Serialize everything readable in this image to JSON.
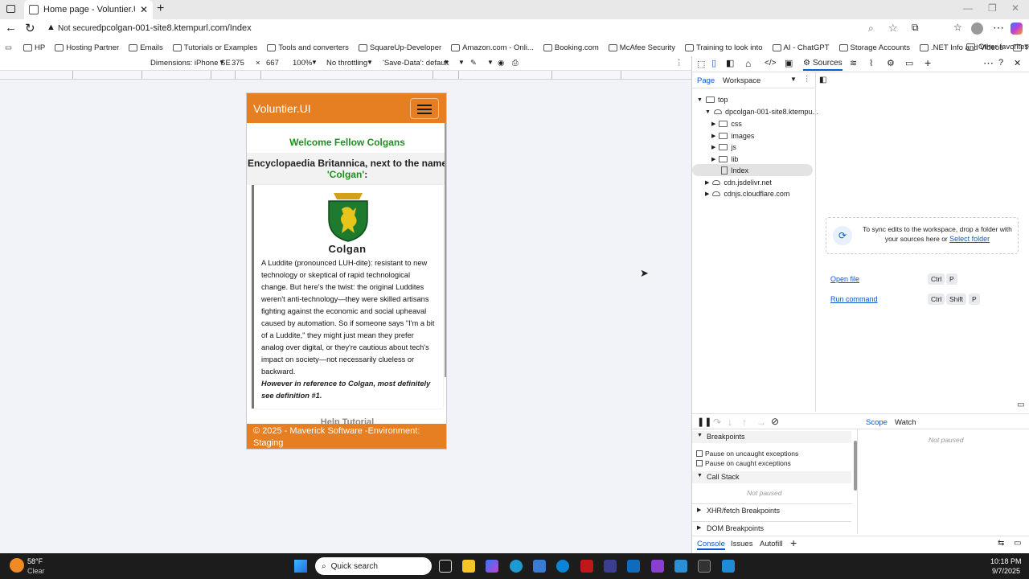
{
  "browser": {
    "tab_title": "Home page - Voluntier.UI",
    "security": "Not secure",
    "url": "dpcolgan-001-site8.ktempurl.com/Index",
    "favorites": [
      "HP",
      "Hosting Partner",
      "Emails",
      "Tutorials or Examples",
      "Tools and converters",
      "SquareUp-Developer",
      "Amazon.com - Onli...",
      "Booking.com",
      "McAfee Security",
      "Training to look into",
      "AI - ChatGPT",
      "Storage Accounts",
      ".NET Info and Videos",
      "Twilio"
    ],
    "other_favorites": "Other favorites"
  },
  "device_toolbar": {
    "dimensions": "Dimensions: iPhone SE",
    "width": "375",
    "x": "×",
    "height": "667",
    "zoom": "100%",
    "throttling": "No throttling",
    "save_data": "'Save-Data': default"
  },
  "site": {
    "brand": "Voluntier.UI",
    "welcome": "Welcome Fellow Colgans",
    "heading_pre": "Encyclopaedia Britannica, next to the name",
    "heading_name": "'Colgan'",
    "heading_post": ":",
    "crest_caption": "Colgan",
    "description": "A Luddite (pronounced LUH-dite): resistant to new technology or skeptical of rapid technological change. But here's the twist: the original Luddites weren't anti-technology—they were skilled artisans fighting against the economic and social upheaval caused by automation. So if someone says \"I'm a bit of a Luddite,\" they might just mean they prefer analog over digital, or they're cautious about tech's impact on society—not necessarily clueless or backward.",
    "emphasis": "However in reference to Colgan, most definitely see definition #1.",
    "help_tutorial": "Help Tutorial",
    "footer": "© 2025 - Maverick Software -Environment: Staging"
  },
  "devtools": {
    "active_tab": "Sources",
    "subtabs": [
      "Page",
      "Workspace"
    ],
    "tree": {
      "top": "top",
      "site": "dpcolgan-001-site8.ktempu...",
      "folders": [
        "css",
        "images",
        "js",
        "lib"
      ],
      "file": "Index",
      "cdn1": "cdn.jsdelivr.net",
      "cdn2": "cdnjs.cloudflare.com"
    },
    "sync_text": "To sync edits to the workspace, drop a folder with your sources here or",
    "select_folder": "Select folder",
    "open_file": "Open file",
    "run_command": "Run command",
    "keys_open": [
      "Ctrl",
      "P"
    ],
    "keys_run": [
      "Ctrl",
      "Shift",
      "P"
    ],
    "breakpoints": "Breakpoints",
    "pause_uncaught": "Pause on uncaught exceptions",
    "pause_caught": "Pause on caught exceptions",
    "call_stack": "Call Stack",
    "not_paused": "Not paused",
    "xhr": "XHR/fetch Breakpoints",
    "dom": "DOM Breakpoints",
    "scope": "Scope",
    "watch": "Watch",
    "drawer_tabs": [
      "Console",
      "Issues",
      "Autofill"
    ]
  },
  "taskbar": {
    "temp": "58°F",
    "weather": "Clear",
    "search": "Quick search",
    "time": "10:18 PM",
    "date": "9/7/2025"
  }
}
